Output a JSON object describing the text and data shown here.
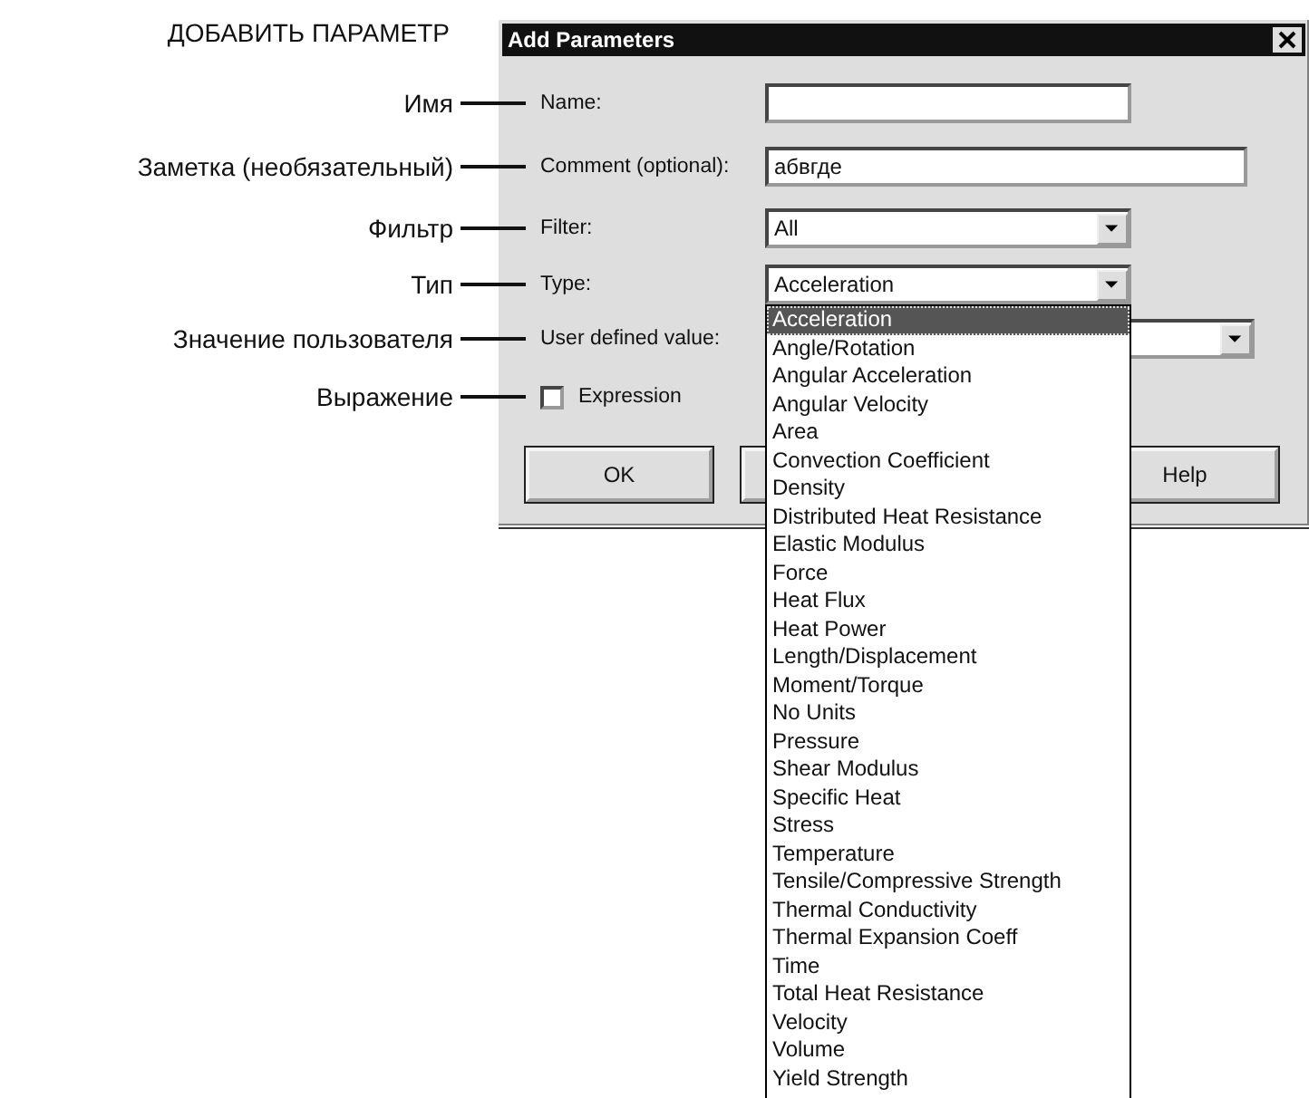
{
  "annotation_title": "ДОБАВИТЬ ПАРАМЕТР",
  "dialog": {
    "title": "Add Parameters",
    "fields": [
      {
        "kind": "text",
        "annotation": "Имя",
        "label": "Name:"
      },
      {
        "kind": "text-wide",
        "annotation": "Заметка (необязательный)",
        "label": "Comment (optional):",
        "value": "абвгде"
      },
      {
        "kind": "dropdown",
        "annotation": "Фильтр",
        "label": "Filter:",
        "value": "All",
        "expanded": false
      },
      {
        "kind": "dropdown",
        "annotation": "Тип",
        "label": "Type:",
        "value": "Acceleration",
        "expanded": true
      },
      {
        "kind": "dropdown-wide",
        "annotation": "Значение пользователя",
        "label": "User defined value:",
        "expanded": false
      },
      {
        "kind": "checkbox",
        "annotation": "Выражение",
        "label": "Expression",
        "checked": false
      }
    ],
    "buttons": [
      {
        "kind": "button",
        "label": "OK"
      },
      {
        "kind": "covered"
      },
      {
        "kind": "button",
        "label": "Help"
      }
    ],
    "type_list": {
      "items": [
        {
          "label": "Acceleration",
          "selected": true
        },
        {
          "label": "Angle/Rotation",
          "selected": false
        },
        {
          "label": "Angular Acceleration",
          "selected": false
        },
        {
          "label": "Angular Velocity",
          "selected": false
        },
        {
          "label": "Area",
          "selected": false
        },
        {
          "label": "Convection Coefficient",
          "selected": false
        },
        {
          "label": "Density",
          "selected": false
        },
        {
          "label": "Distributed Heat Resistance",
          "selected": false
        },
        {
          "label": "Elastic Modulus",
          "selected": false
        },
        {
          "label": "Force",
          "selected": false
        },
        {
          "label": "Heat Flux",
          "selected": false
        },
        {
          "label": "Heat Power",
          "selected": false
        },
        {
          "label": "Length/Displacement",
          "selected": false
        },
        {
          "label": "Moment/Torque",
          "selected": false
        },
        {
          "label": "No Units",
          "selected": false
        },
        {
          "label": "Pressure",
          "selected": false
        },
        {
          "label": "Shear Modulus",
          "selected": false
        },
        {
          "label": "Specific Heat",
          "selected": false
        },
        {
          "label": "Stress",
          "selected": false
        },
        {
          "label": "Temperature",
          "selected": false
        },
        {
          "label": "Tensile/Compressive Strength",
          "selected": false
        },
        {
          "label": "Thermal Conductivity",
          "selected": false
        },
        {
          "label": "Thermal Expansion Coeff",
          "selected": false
        },
        {
          "label": "Time",
          "selected": false
        },
        {
          "label": "Total Heat Resistance",
          "selected": false
        },
        {
          "label": "Velocity",
          "selected": false
        },
        {
          "label": "Volume",
          "selected": false
        },
        {
          "label": "Yield Strength",
          "selected": false
        }
      ]
    }
  }
}
